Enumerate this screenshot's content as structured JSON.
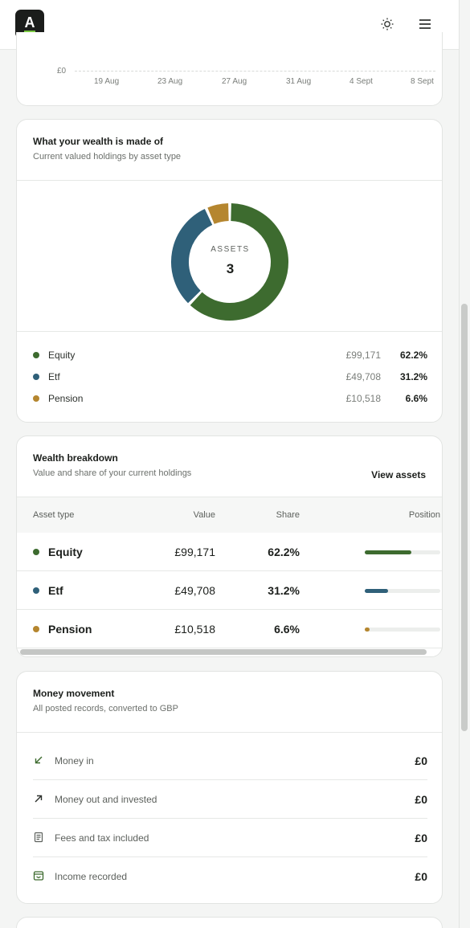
{
  "header": {
    "logo_text": "A",
    "theme_icon": "sun-icon",
    "menu_icon": "hamburger-menu-icon"
  },
  "chart_data": {
    "type": "line",
    "categories": [
      "19 Aug",
      "23 Aug",
      "27 Aug",
      "31 Aug",
      "4 Sept",
      "8 Sept"
    ],
    "y_tick_label": "£0",
    "series": []
  },
  "wealth": {
    "title": "What your wealth is made of",
    "subtitle": "Current valued holdings by asset type",
    "center_label": "ASSETS",
    "center_value": "3",
    "items": [
      {
        "name": "Equity",
        "value": "£99,171",
        "share": "62.2%",
        "share_num": 62.2,
        "color": "#3d6b2f"
      },
      {
        "name": "Etf",
        "value": "£49,708",
        "share": "31.2%",
        "share_num": 31.2,
        "color": "#2f6079"
      },
      {
        "name": "Pension",
        "value": "£10,518",
        "share": "6.6%",
        "share_num": 6.6,
        "color": "#b5862f"
      }
    ]
  },
  "breakdown": {
    "title": "Wealth breakdown",
    "subtitle": "Value and share of your current holdings",
    "view_assets": "View assets",
    "columns": [
      "Asset type",
      "Value",
      "Share",
      "Position"
    ]
  },
  "money": {
    "title": "Money movement",
    "subtitle": "All posted records, converted to GBP",
    "rows": [
      {
        "label": "Money in",
        "value": "£0",
        "icon": "arrow-down-left-icon"
      },
      {
        "label": "Money out and invested",
        "value": "£0",
        "icon": "arrow-up-right-icon"
      },
      {
        "label": "Fees and tax included",
        "value": "£0",
        "icon": "receipt-icon"
      },
      {
        "label": "Income recorded",
        "value": "£0",
        "icon": "income-box-icon"
      }
    ]
  }
}
